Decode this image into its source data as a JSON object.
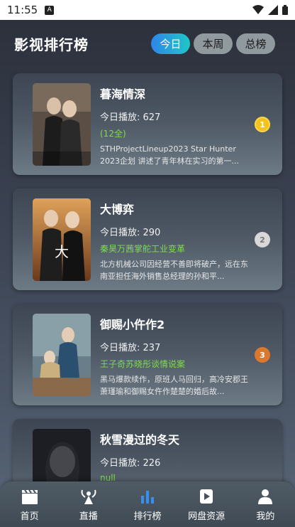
{
  "status": {
    "time": "11:55",
    "a_icon": "A"
  },
  "header": {
    "title": "影视排行榜"
  },
  "tabs": [
    {
      "label": "今日",
      "active": true
    },
    {
      "label": "本周",
      "active": false
    },
    {
      "label": "总榜",
      "active": false
    }
  ],
  "items": [
    {
      "name": "暮海情深",
      "plays": "今日播放: 627",
      "sub": "(12全)",
      "desc": "STHProjectLineup2023 Star Hunter 2023企划 讲述了青年林在实习的第一...",
      "rank": "1"
    },
    {
      "name": "大博弈",
      "plays": "今日播放: 290",
      "sub": "秦昊万茜掌舵工业变革",
      "desc": "北方机械公司因经营不善即将破产，远在东南亚担任海外销售总经理的孙和平...",
      "rank": "2"
    },
    {
      "name": "御赐小仵作2",
      "plays": "今日播放: 237",
      "sub": "王子奇苏晓彤谈情说案",
      "desc": "黑马爆款续作，原班人马回归，高冷安郡王萧瑾瑜和御赐女仵作楚楚的婚后故...",
      "rank": "3"
    },
    {
      "name": "秋雪漫过的冬天",
      "plays": "今日播放: 226",
      "sub": "null",
      "desc": "",
      "rank": ""
    }
  ],
  "nav": [
    {
      "label": "首页",
      "icon": "clapperboard-icon"
    },
    {
      "label": "直播",
      "icon": "broadcast-icon"
    },
    {
      "label": "排行榜",
      "icon": "bar-chart-icon",
      "active": true
    },
    {
      "label": "网盘资源",
      "icon": "cloud-play-icon"
    },
    {
      "label": "我的",
      "icon": "person-icon"
    }
  ]
}
